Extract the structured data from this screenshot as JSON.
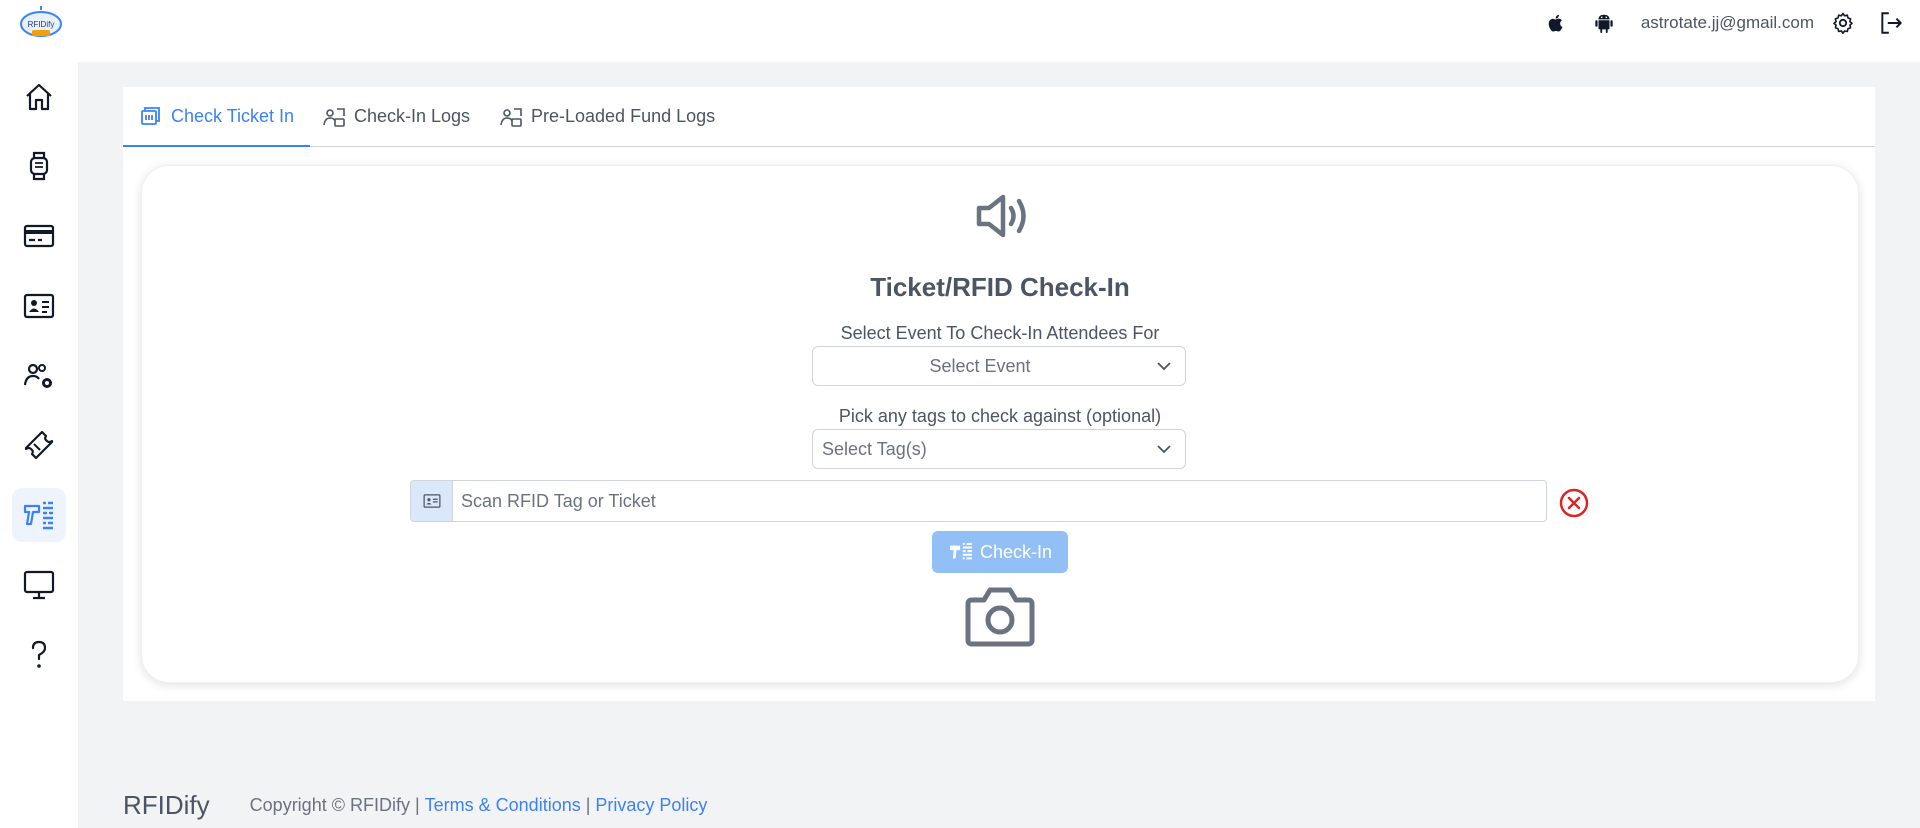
{
  "user": {
    "email": "astrotate.jj@gmail.com"
  },
  "logo": {
    "text": "RFIDify"
  },
  "sidebar": {
    "items": [
      {
        "icon": "home-icon"
      },
      {
        "icon": "watch-icon"
      },
      {
        "icon": "credit-card-icon"
      },
      {
        "icon": "id-card-icon"
      },
      {
        "icon": "users-gear-icon"
      },
      {
        "icon": "ticket-icon"
      },
      {
        "icon": "scanner-icon",
        "active": true
      },
      {
        "icon": "monitor-icon"
      },
      {
        "icon": "help-icon"
      }
    ]
  },
  "tabs": [
    {
      "label": "Check Ticket In",
      "active": true
    },
    {
      "label": "Check-In Logs"
    },
    {
      "label": "Pre-Loaded Fund Logs"
    }
  ],
  "checkin": {
    "title": "Ticket/RFID Check-In",
    "event_label": "Select Event To Check-In Attendees For",
    "event_value": "Select Event",
    "tags_label": "Pick any tags to check against (optional)",
    "tags_value": "Select Tag(s)",
    "scan_placeholder": "Scan RFID Tag or Ticket",
    "button_label": "Check-In"
  },
  "footer": {
    "brand": "RFIDify",
    "copyright": "Copyright © RFIDify |",
    "terms": "Terms & Conditions",
    "separator": "|",
    "privacy": "Privacy Policy"
  },
  "colors": {
    "accent": "#3b82f6",
    "button_disabled": "#93bff7",
    "danger": "#dc2626",
    "text": "#4b5563"
  }
}
